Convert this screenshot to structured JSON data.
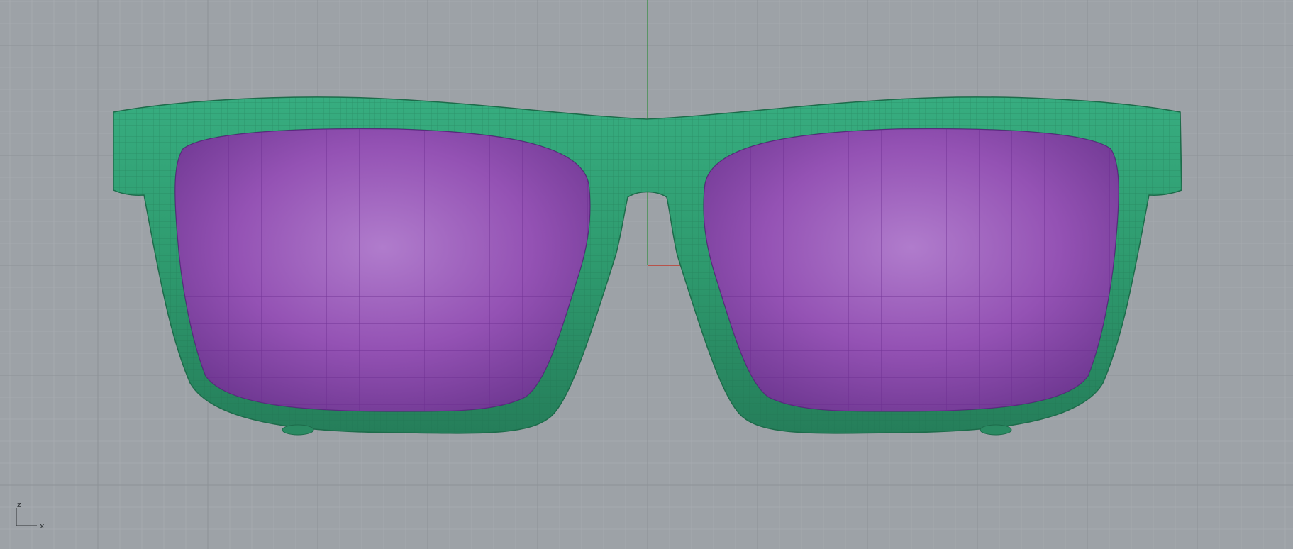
{
  "viewport": {
    "projection": "front-view",
    "background_color": "#9da2a7",
    "grid": true,
    "colors": {
      "grid_minor": "#a9adb2",
      "grid_major": "#8d9297",
      "axis_x": "#c0392b",
      "axis_z": "#2e8b3a",
      "frame_fill": "#2e9a6e",
      "frame_mesh": "#1e6f4d",
      "lens_fill": "#9b5db5",
      "lens_mesh": "#6a2c8f"
    }
  },
  "model": {
    "object": "sunglasses",
    "frame_icon": "sunglasses-frame",
    "lens_icon": "lens-surface"
  },
  "axis_gizmo": {
    "z_label": "z",
    "x_label": "x"
  }
}
